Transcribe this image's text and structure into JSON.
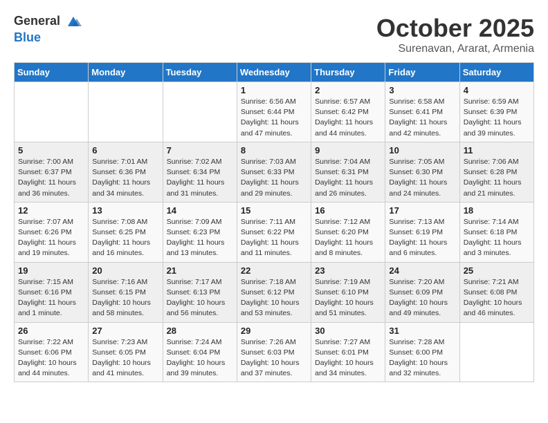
{
  "header": {
    "logo_general": "General",
    "logo_blue": "Blue",
    "month_title": "October 2025",
    "subtitle": "Surenavan, Ararat, Armenia"
  },
  "days_of_week": [
    "Sunday",
    "Monday",
    "Tuesday",
    "Wednesday",
    "Thursday",
    "Friday",
    "Saturday"
  ],
  "weeks": [
    [
      {
        "day": "",
        "info": ""
      },
      {
        "day": "",
        "info": ""
      },
      {
        "day": "",
        "info": ""
      },
      {
        "day": "1",
        "info": "Sunrise: 6:56 AM\nSunset: 6:44 PM\nDaylight: 11 hours and 47 minutes."
      },
      {
        "day": "2",
        "info": "Sunrise: 6:57 AM\nSunset: 6:42 PM\nDaylight: 11 hours and 44 minutes."
      },
      {
        "day": "3",
        "info": "Sunrise: 6:58 AM\nSunset: 6:41 PM\nDaylight: 11 hours and 42 minutes."
      },
      {
        "day": "4",
        "info": "Sunrise: 6:59 AM\nSunset: 6:39 PM\nDaylight: 11 hours and 39 minutes."
      }
    ],
    [
      {
        "day": "5",
        "info": "Sunrise: 7:00 AM\nSunset: 6:37 PM\nDaylight: 11 hours and 36 minutes."
      },
      {
        "day": "6",
        "info": "Sunrise: 7:01 AM\nSunset: 6:36 PM\nDaylight: 11 hours and 34 minutes."
      },
      {
        "day": "7",
        "info": "Sunrise: 7:02 AM\nSunset: 6:34 PM\nDaylight: 11 hours and 31 minutes."
      },
      {
        "day": "8",
        "info": "Sunrise: 7:03 AM\nSunset: 6:33 PM\nDaylight: 11 hours and 29 minutes."
      },
      {
        "day": "9",
        "info": "Sunrise: 7:04 AM\nSunset: 6:31 PM\nDaylight: 11 hours and 26 minutes."
      },
      {
        "day": "10",
        "info": "Sunrise: 7:05 AM\nSunset: 6:30 PM\nDaylight: 11 hours and 24 minutes."
      },
      {
        "day": "11",
        "info": "Sunrise: 7:06 AM\nSunset: 6:28 PM\nDaylight: 11 hours and 21 minutes."
      }
    ],
    [
      {
        "day": "12",
        "info": "Sunrise: 7:07 AM\nSunset: 6:26 PM\nDaylight: 11 hours and 19 minutes."
      },
      {
        "day": "13",
        "info": "Sunrise: 7:08 AM\nSunset: 6:25 PM\nDaylight: 11 hours and 16 minutes."
      },
      {
        "day": "14",
        "info": "Sunrise: 7:09 AM\nSunset: 6:23 PM\nDaylight: 11 hours and 13 minutes."
      },
      {
        "day": "15",
        "info": "Sunrise: 7:11 AM\nSunset: 6:22 PM\nDaylight: 11 hours and 11 minutes."
      },
      {
        "day": "16",
        "info": "Sunrise: 7:12 AM\nSunset: 6:20 PM\nDaylight: 11 hours and 8 minutes."
      },
      {
        "day": "17",
        "info": "Sunrise: 7:13 AM\nSunset: 6:19 PM\nDaylight: 11 hours and 6 minutes."
      },
      {
        "day": "18",
        "info": "Sunrise: 7:14 AM\nSunset: 6:18 PM\nDaylight: 11 hours and 3 minutes."
      }
    ],
    [
      {
        "day": "19",
        "info": "Sunrise: 7:15 AM\nSunset: 6:16 PM\nDaylight: 11 hours and 1 minute."
      },
      {
        "day": "20",
        "info": "Sunrise: 7:16 AM\nSunset: 6:15 PM\nDaylight: 10 hours and 58 minutes."
      },
      {
        "day": "21",
        "info": "Sunrise: 7:17 AM\nSunset: 6:13 PM\nDaylight: 10 hours and 56 minutes."
      },
      {
        "day": "22",
        "info": "Sunrise: 7:18 AM\nSunset: 6:12 PM\nDaylight: 10 hours and 53 minutes."
      },
      {
        "day": "23",
        "info": "Sunrise: 7:19 AM\nSunset: 6:10 PM\nDaylight: 10 hours and 51 minutes."
      },
      {
        "day": "24",
        "info": "Sunrise: 7:20 AM\nSunset: 6:09 PM\nDaylight: 10 hours and 49 minutes."
      },
      {
        "day": "25",
        "info": "Sunrise: 7:21 AM\nSunset: 6:08 PM\nDaylight: 10 hours and 46 minutes."
      }
    ],
    [
      {
        "day": "26",
        "info": "Sunrise: 7:22 AM\nSunset: 6:06 PM\nDaylight: 10 hours and 44 minutes."
      },
      {
        "day": "27",
        "info": "Sunrise: 7:23 AM\nSunset: 6:05 PM\nDaylight: 10 hours and 41 minutes."
      },
      {
        "day": "28",
        "info": "Sunrise: 7:24 AM\nSunset: 6:04 PM\nDaylight: 10 hours and 39 minutes."
      },
      {
        "day": "29",
        "info": "Sunrise: 7:26 AM\nSunset: 6:03 PM\nDaylight: 10 hours and 37 minutes."
      },
      {
        "day": "30",
        "info": "Sunrise: 7:27 AM\nSunset: 6:01 PM\nDaylight: 10 hours and 34 minutes."
      },
      {
        "day": "31",
        "info": "Sunrise: 7:28 AM\nSunset: 6:00 PM\nDaylight: 10 hours and 32 minutes."
      },
      {
        "day": "",
        "info": ""
      }
    ]
  ]
}
